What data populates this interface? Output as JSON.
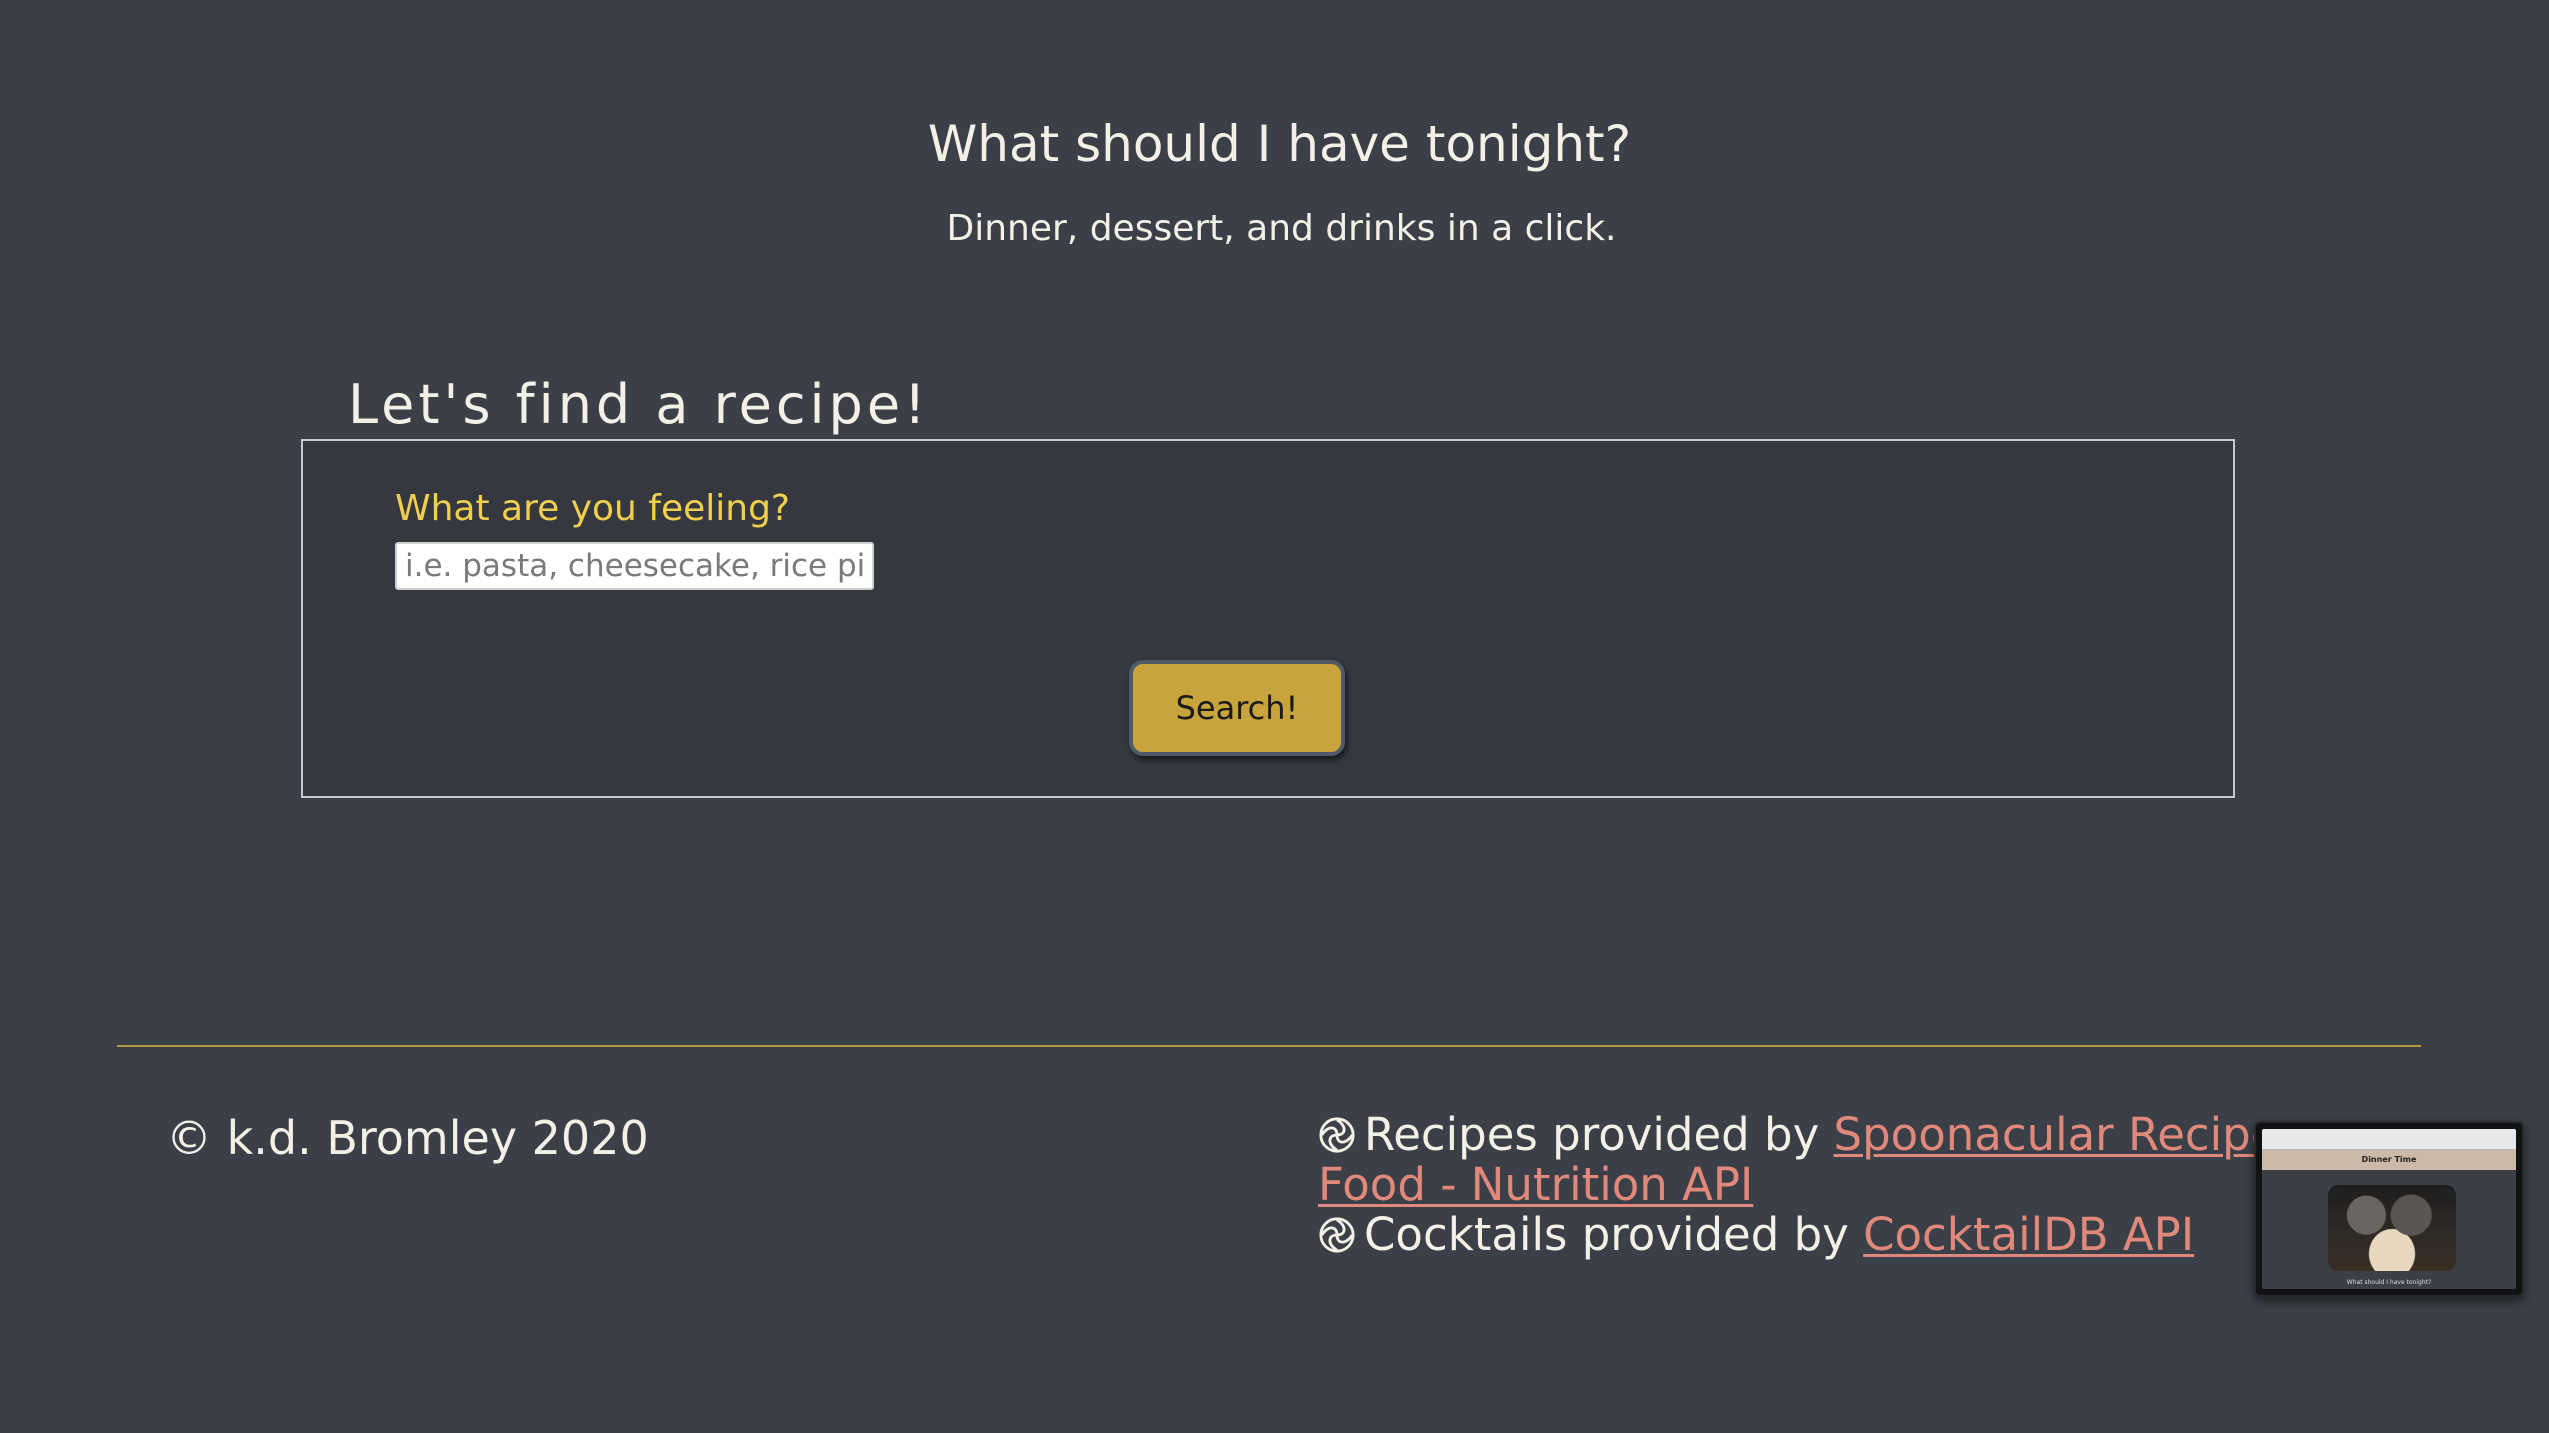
{
  "hero": {
    "title": "What should I have tonight?",
    "subtitle": "Dinner, dessert, and drinks in a click."
  },
  "search_section": {
    "heading": "Let's find a recipe!",
    "field_label": "What are you feeling?",
    "input_value": "",
    "input_placeholder": "i.e. pasta, cheesecake, rice pil",
    "button_label": "Search!"
  },
  "footer": {
    "copyright": "© k.d. Bromley 2020",
    "credits": [
      {
        "icon": "swirl-icon",
        "prefix": "Recipes provided by ",
        "link_text": "Spoonacular Recipe Food - Nutrition API"
      },
      {
        "icon": "swirl-icon",
        "prefix": "Cocktails provided by ",
        "link_text": "CocktailDB API"
      }
    ]
  },
  "preview": {
    "nav_title": "Dinner Time",
    "caption": "What should I have tonight?"
  },
  "colors": {
    "background": "#3b3f47",
    "panel": "#35383e",
    "accent_yellow": "#f0cf4e",
    "button": "#c8a43c",
    "link": "#e0897a",
    "rule": "#b49a3a"
  }
}
